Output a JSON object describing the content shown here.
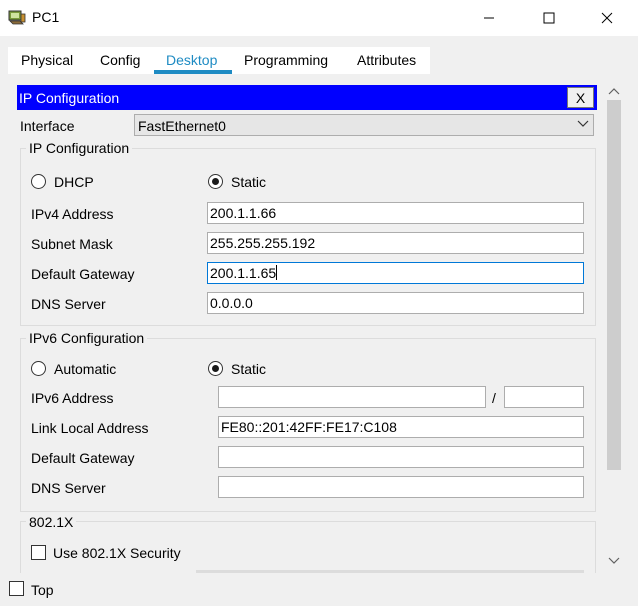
{
  "window": {
    "title": "PC1",
    "minimize_icon": "minimize-icon",
    "maximize_icon": "maximize-icon",
    "close_icon": "close-icon"
  },
  "tabs": [
    {
      "label": "Physical"
    },
    {
      "label": "Config"
    },
    {
      "label": "Desktop",
      "active": true
    },
    {
      "label": "Programming"
    },
    {
      "label": "Attributes"
    }
  ],
  "ip_config": {
    "header": "IP Configuration",
    "close_label": "X",
    "interface_label": "Interface",
    "interface_value": "FastEthernet0",
    "ipv4_group": {
      "title": "IP Configuration",
      "dhcp_label": "DHCP",
      "static_label": "Static",
      "mode": "Static",
      "ipv4_label": "IPv4 Address",
      "ipv4_value": "200.1.1.66",
      "mask_label": "Subnet Mask",
      "mask_value": "255.255.255.192",
      "gateway_label": "Default Gateway",
      "gateway_value": "200.1.1.65",
      "dns_label": "DNS Server",
      "dns_value": "0.0.0.0"
    },
    "ipv6_group": {
      "title": "IPv6 Configuration",
      "auto_label": "Automatic",
      "static_label": "Static",
      "mode": "Static",
      "ipv6_label": "IPv6 Address",
      "ipv6_value": "",
      "prefix_sep": "/",
      "prefix_value": "",
      "link_local_label": "Link Local Address",
      "link_local_value": "FE80::201:42FF:FE17:C108",
      "gateway_label": "Default Gateway",
      "gateway_value": "",
      "dns_label": "DNS Server",
      "dns_value": ""
    },
    "dot1x_group": {
      "title": "802.1X",
      "checkbox_label": "Use 802.1X Security"
    }
  },
  "footer": {
    "top_label": "Top"
  },
  "colors": {
    "accent": "#1e8bc3",
    "header_blue": "#0000ff"
  }
}
